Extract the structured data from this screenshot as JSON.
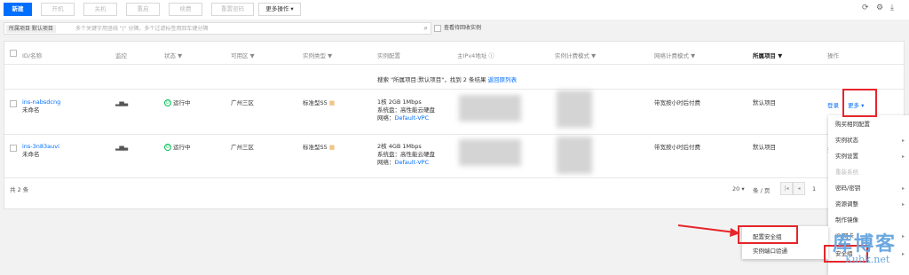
{
  "toolbar": {
    "new_label": "新建",
    "power_on": "开机",
    "power_off": "关机",
    "restart": "重启",
    "renew": "续费",
    "reset_pwd": "重置密码",
    "more_ops": "更多操作",
    "more_ops_caret": "▾",
    "icons": [
      "refresh-icon",
      "settings-icon",
      "download-icon"
    ]
  },
  "filter": {
    "tag_label": "所属项目 默认项目",
    "placeholder": "多个关键字用竖线 \"|\" 分隔，多个过滤标签用回车键分隔",
    "recycle_label": "查看待回收实例"
  },
  "table": {
    "headers": [
      "ID/名称",
      "监控",
      "状态 ▼",
      "可用区 ▼",
      "实例类型 ▼",
      "实例配置",
      "主IPv4地址 ⓘ",
      "实例计费模式 ▼",
      "网络计费模式 ▼",
      "所属项目 ▼",
      "操作"
    ],
    "notice_prefix": "搜索 \"所属项目:默认项目\"，找到 2 条结果",
    "notice_link": "返回原列表",
    "rows": [
      {
        "id": "ins-nabsdcng",
        "name": "未命名",
        "status": "运行中",
        "zone": "广州三区",
        "type": "标准型S5",
        "config_line1": "1核 2GB 1Mbps",
        "config_line2": "系统盘：高性能云硬盘",
        "config_net_label": "网络：",
        "config_net": "Default-VPC",
        "net_billing": "带宽按小时后付费",
        "project": "默认项目",
        "op_login": "登录",
        "op_more": "更多 ▾"
      },
      {
        "id": "ins-3n83auvi",
        "name": "未命名",
        "status": "运行中",
        "zone": "广州三区",
        "type": "标准型S5",
        "config_line1": "2核 4GB 1Mbps",
        "config_line2": "系统盘：高性能云硬盘",
        "config_net_label": "网络：",
        "config_net": "Default-VPC",
        "net_billing": "带宽按小时后付费",
        "project": "默认项目",
        "op_login": "登"
      }
    ],
    "total": "共 2 条"
  },
  "pagination": {
    "page_size": "20 ▾",
    "per_page": "条 / 页",
    "first": "|◂",
    "prev": "◂",
    "page": "1"
  },
  "more_menu": {
    "items": [
      {
        "label": "购买相同配置",
        "disabled": false,
        "arrow": false
      },
      {
        "label": "实例状态",
        "disabled": false,
        "arrow": true
      },
      {
        "label": "实例设置",
        "disabled": false,
        "arrow": true
      },
      {
        "label": "重装系统",
        "disabled": true,
        "arrow": false
      },
      {
        "label": "密码/密钥",
        "disabled": false,
        "arrow": true
      },
      {
        "label": "资源调整",
        "disabled": false,
        "arrow": true
      },
      {
        "label": "制作镜像",
        "disabled": false,
        "arrow": false
      },
      {
        "label": "IP/网卡",
        "disabled": false,
        "arrow": true
      },
      {
        "label": "安全组",
        "disabled": false,
        "arrow": true
      }
    ],
    "arrow_glyph": "▸"
  },
  "security_submenu": {
    "items": [
      "配置安全组",
      "实例端口验通"
    ]
  },
  "watermark": {
    "title": "库博客",
    "sub": "Kubk.net"
  },
  "colors": {
    "accent": "#006eff",
    "running": "#0abf5b",
    "highlight": "#e5262b"
  }
}
